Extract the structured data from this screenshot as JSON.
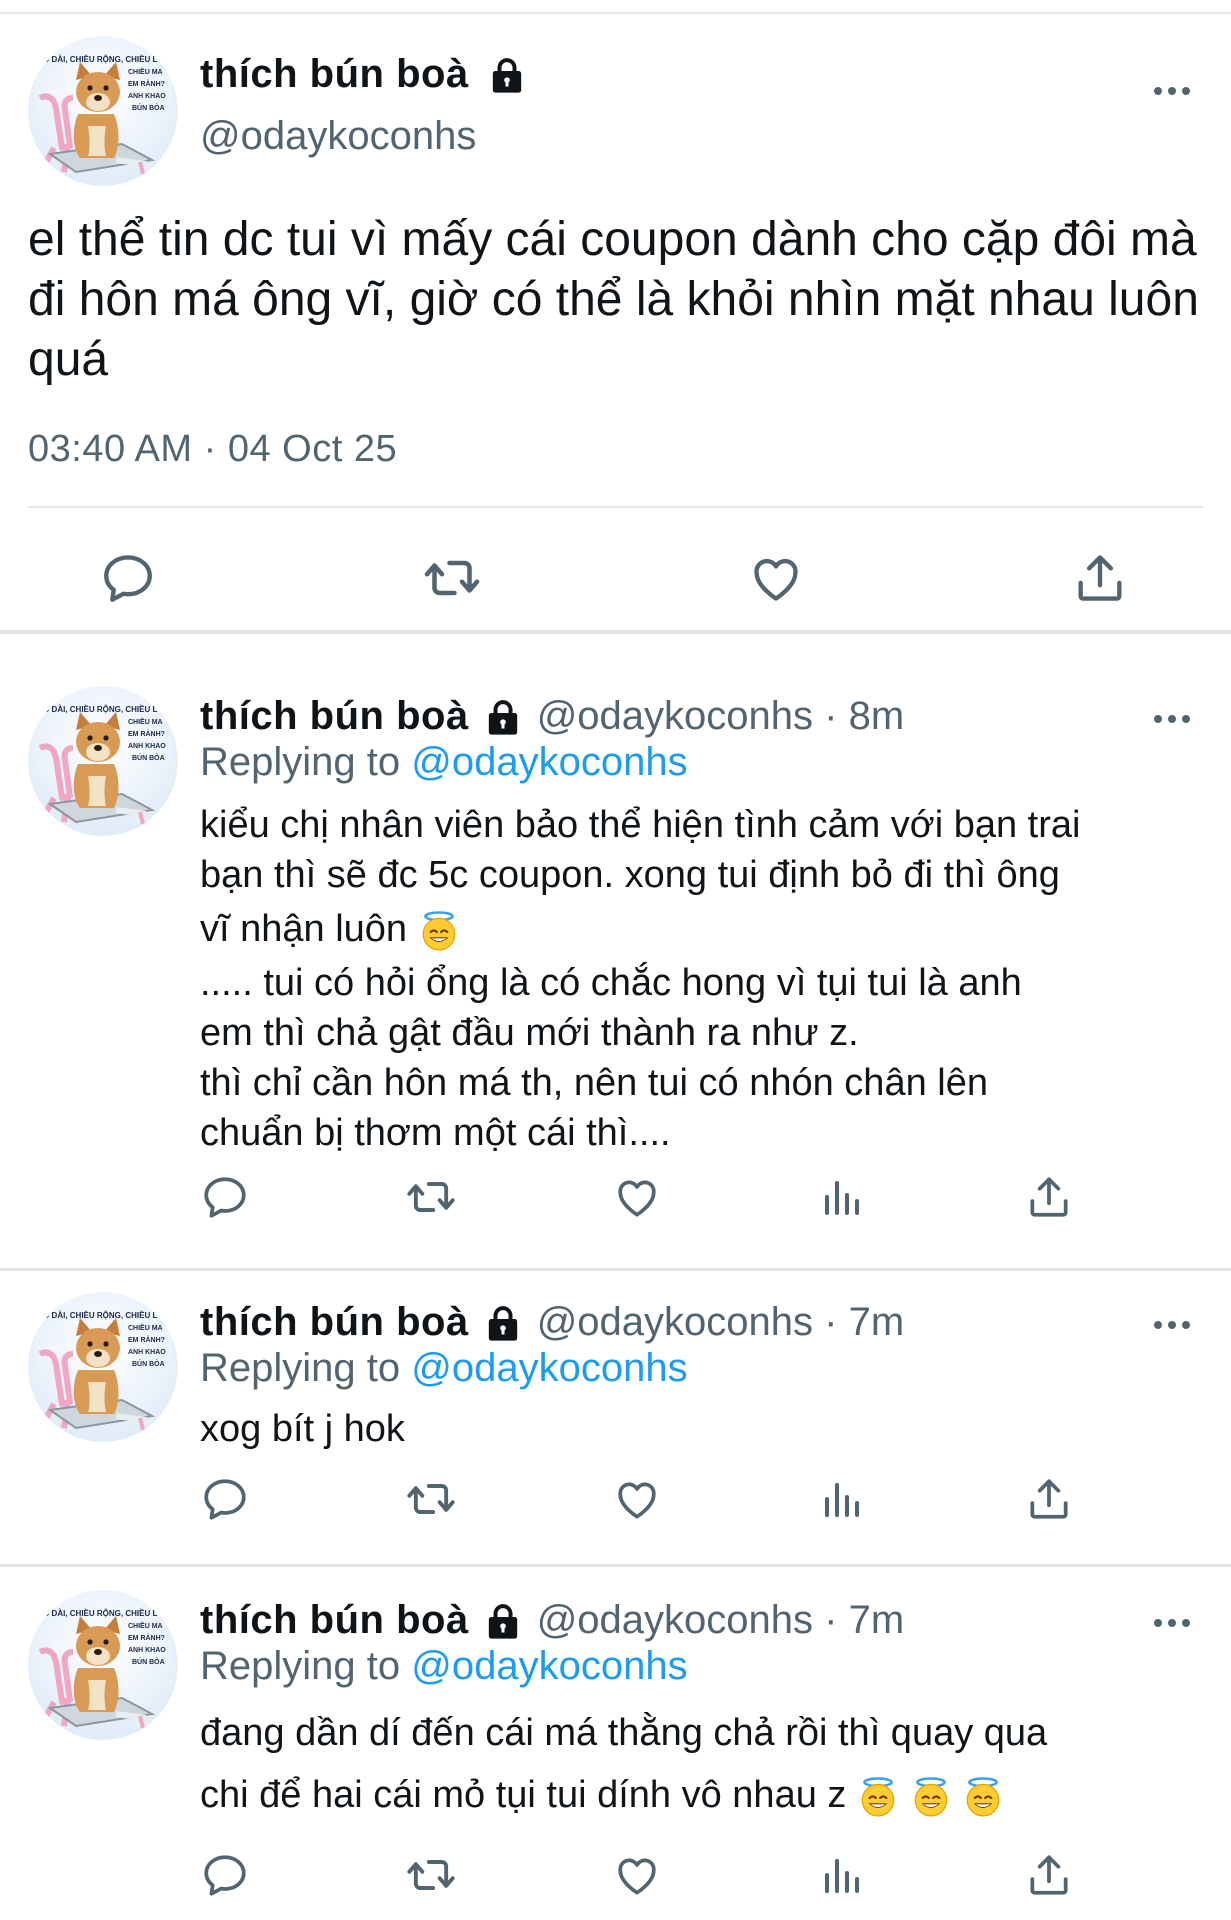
{
  "main_tweet": {
    "display_name": "thích bún boà",
    "handle": "@odaykoconhs",
    "text": "el thể tin dc tui vì mấy cái coupon dành cho cặp đôi mà đi hôn má ông vĩ, giờ có thể là khỏi nhìn mặt nhau luôn quá",
    "timestamp": "03:40 AM · 04 Oct 25",
    "avatar_text": [
      "IỀU DÀI, CHIỀU RỘNG, CHIỀU L",
      "CHIỀU MA",
      "EM RẢNH?",
      "ANH KHAO",
      "BÚN BÒA"
    ],
    "actions": [
      "reply-icon",
      "retweet-icon",
      "like-icon",
      "share-icon"
    ]
  },
  "replies": [
    {
      "display_name": "thích bún boà",
      "handle": "@odaykoconhs",
      "separator": "·",
      "time": "8m",
      "replying_label": "Replying to",
      "replying_to": "@odaykoconhs",
      "lines": [
        "kiểu chị nhân viên bảo thể hiện tình cảm với bạn trai",
        "bạn thì sẽ đc 5c coupon. xong tui định bỏ đi thì ông",
        "vĩ nhận luôn",
        ".....  tui có hỏi ổng là có chắc hong vì tụi tui là anh",
        "em thì chả gật đầu mới thành ra như z.",
        "thì chỉ cần hôn má th, nên tui có nhón chân lên",
        "chuẩn bị thơm một cái thì...."
      ],
      "emoji": "halo-smile-emoji"
    },
    {
      "display_name": "thích bún boà",
      "handle": "@odaykoconhs",
      "separator": "·",
      "time": "7m",
      "replying_label": "Replying to",
      "replying_to": "@odaykoconhs",
      "lines": [
        "xog bít j hok"
      ]
    },
    {
      "display_name": "thích bún boà",
      "handle": "@odaykoconhs",
      "separator": "·",
      "time": "7m",
      "replying_label": "Replying to",
      "replying_to": "@odaykoconhs",
      "lines": [
        "đang dần dí đến cái má thằng chả rồi thì quay qua",
        "chi để hai cái mỏ tụi tui dính vô nhau z"
      ],
      "emoji": "halo-smile-emoji"
    }
  ],
  "colors": {
    "text": "#0f1419",
    "secondary": "#536471",
    "link": "#1d9bf0",
    "divider": "#e1e4e8"
  }
}
